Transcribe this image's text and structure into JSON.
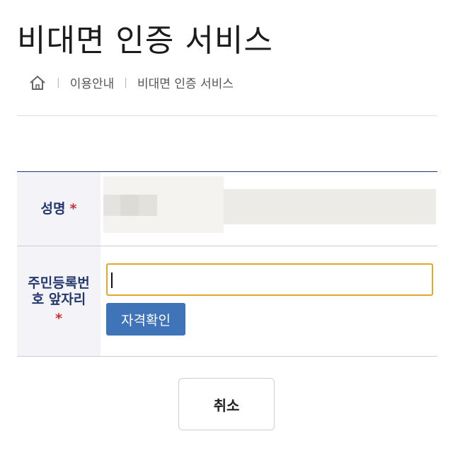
{
  "page": {
    "title": "비대면 인증 서비스"
  },
  "breadcrumb": {
    "home_icon": "home-icon",
    "items": [
      "이용안내",
      "비대면 인증 서비스"
    ]
  },
  "form": {
    "name_label": "성명",
    "required_mark": "*",
    "id_label_line1": "주민등록번",
    "id_label_line2": "호 앞자리",
    "id_input_value": "",
    "check_button_label": "자격확인"
  },
  "actions": {
    "cancel_label": "취소"
  },
  "colors": {
    "label_text": "#23386f",
    "required": "#d32f2f",
    "input_focus_border": "#e0a92e",
    "primary_button": "#3f74b8"
  }
}
